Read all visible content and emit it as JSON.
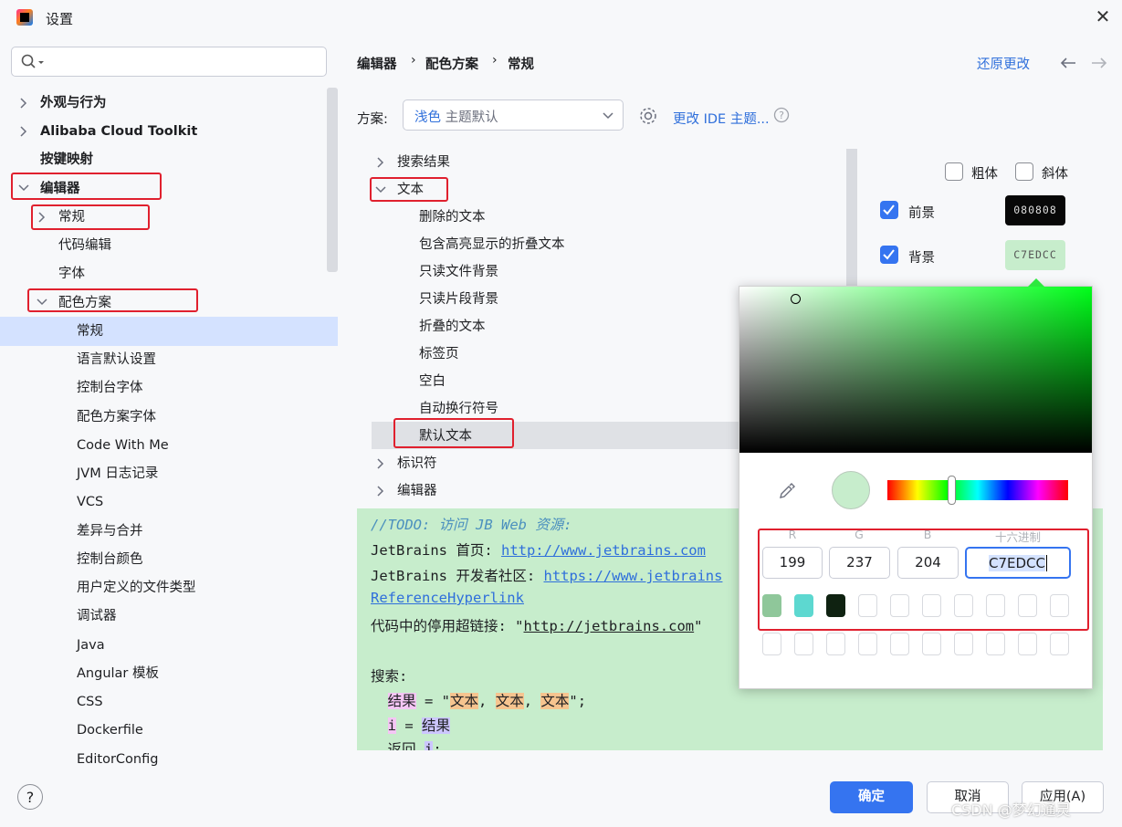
{
  "window": {
    "title": "设置"
  },
  "sidebar": {
    "search_placeholder": "",
    "items": [
      {
        "label": "外观与行为"
      },
      {
        "label": "Alibaba Cloud Toolkit"
      },
      {
        "label": "按键映射"
      },
      {
        "label": "编辑器"
      },
      {
        "label": "常规"
      },
      {
        "label": "代码编辑"
      },
      {
        "label": "字体"
      },
      {
        "label": "配色方案"
      },
      {
        "label": "常规"
      },
      {
        "label": "语言默认设置"
      },
      {
        "label": "控制台字体"
      },
      {
        "label": "配色方案字体"
      },
      {
        "label": "Code With Me"
      },
      {
        "label": "JVM 日志记录"
      },
      {
        "label": "VCS"
      },
      {
        "label": "差异与合并"
      },
      {
        "label": "控制台颜色"
      },
      {
        "label": "用户定义的文件类型"
      },
      {
        "label": "调试器"
      },
      {
        "label": "Java"
      },
      {
        "label": "Angular 模板"
      },
      {
        "label": "CSS"
      },
      {
        "label": "Dockerfile"
      },
      {
        "label": "EditorConfig"
      }
    ]
  },
  "breadcrumb": [
    "编辑器",
    "配色方案",
    "常规"
  ],
  "header": {
    "revert_label": "还原更改"
  },
  "scheme": {
    "label": "方案:",
    "value_name": "浅色",
    "value_suffix": "主题默认",
    "ide_theme_link": "更改 IDE 主题..."
  },
  "tree": {
    "items": [
      {
        "label": "搜索结果"
      },
      {
        "label": "文本"
      },
      {
        "label": "删除的文本"
      },
      {
        "label": "包含高亮显示的折叠文本"
      },
      {
        "label": "只读文件背景"
      },
      {
        "label": "只读片段背景"
      },
      {
        "label": "折叠的文本"
      },
      {
        "label": "标签页"
      },
      {
        "label": "空白"
      },
      {
        "label": "自动换行符号"
      },
      {
        "label": "默认文本"
      },
      {
        "label": "标识符"
      },
      {
        "label": "编辑器"
      }
    ]
  },
  "attributes": {
    "bold_label": "粗体",
    "italic_label": "斜体",
    "foreground_label": "前景",
    "foreground_hex": "080808",
    "background_label": "背景",
    "background_hex": "C7EDCC"
  },
  "preview": {
    "todo": "//TODO: 访问 JB Web 资源:",
    "line1_text": "JetBrains 首页: ",
    "line1_link": "http://www.jetbrains.com",
    "line2_text": "JetBrains 开发者社区: ",
    "line2_link": "https://www.jetbrains",
    "line3_link": "ReferenceHyperlink",
    "line4_text": "代码中的停用超链接: \"",
    "line4_url": "http://jetbrains.com",
    "line4_end": "\"",
    "search_label": "搜索:",
    "result_word": "结果",
    "text_word": "文本",
    "var_i": "i",
    "return_word": "返回"
  },
  "picker": {
    "r_label": "R",
    "g_label": "G",
    "b_label": "B",
    "hex_label": "十六进制",
    "r": "199",
    "g": "237",
    "b": "204",
    "hex": "C7EDCC",
    "current_color": "#c7edcc",
    "recent_colors": [
      "#8fc79a",
      "#5dd8d0",
      "#0f2211"
    ]
  },
  "buttons": {
    "ok": "确定",
    "cancel": "取消",
    "apply": "应用(A)",
    "help": "?"
  },
  "watermark": "CSDN @梦幻通灵"
}
